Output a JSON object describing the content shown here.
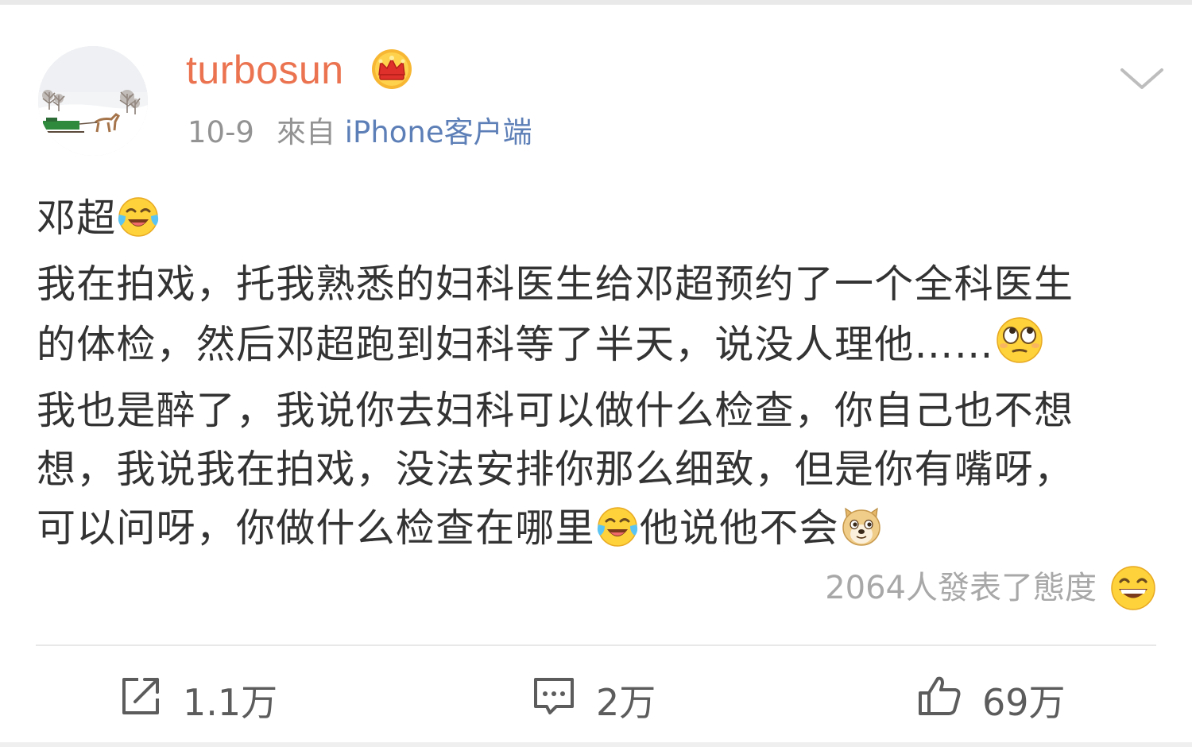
{
  "post": {
    "username": "turbosun",
    "date": "10-9",
    "via": "來自",
    "source": "iPhone客户端",
    "content": {
      "line1": "邓超",
      "line2": "我在拍戏，托我熟悉的妇科医生给邓超预约了一个全科医生",
      "line3": "的体检，然后邓超跑到妇科等了半天，说没人理他……",
      "line4": "我也是醉了，我说你去妇科可以做什么检查，你自己也不想",
      "line5": "想，我说我在拍戏，没法安排你那么细致，但是你有嘴呀，",
      "line6a": "可以问呀，你做什么检查在哪里",
      "line6b": "他说他不会"
    },
    "reactions_text": "2064人發表了態度",
    "actions": {
      "repost_count": "1.1万",
      "comment_count": "2万",
      "like_count": "69万"
    }
  },
  "icons": {
    "avatar": "avatar-image",
    "badge": "crown-icon",
    "menu": "chevron-down-icon",
    "emoji_laugh_cry": "laugh-cry-emoji",
    "emoji_eye_roll": "eye-roll-emoji",
    "emoji_doge": "doge-emoji",
    "emoji_grin": "grin-emoji",
    "repost": "repost-icon",
    "comment": "comment-icon",
    "like": "thumbs-up-icon"
  },
  "colors": {
    "username": "#eb7350",
    "source_link": "#5d7fb7",
    "body_text": "#333333",
    "meta_text": "#939393"
  }
}
